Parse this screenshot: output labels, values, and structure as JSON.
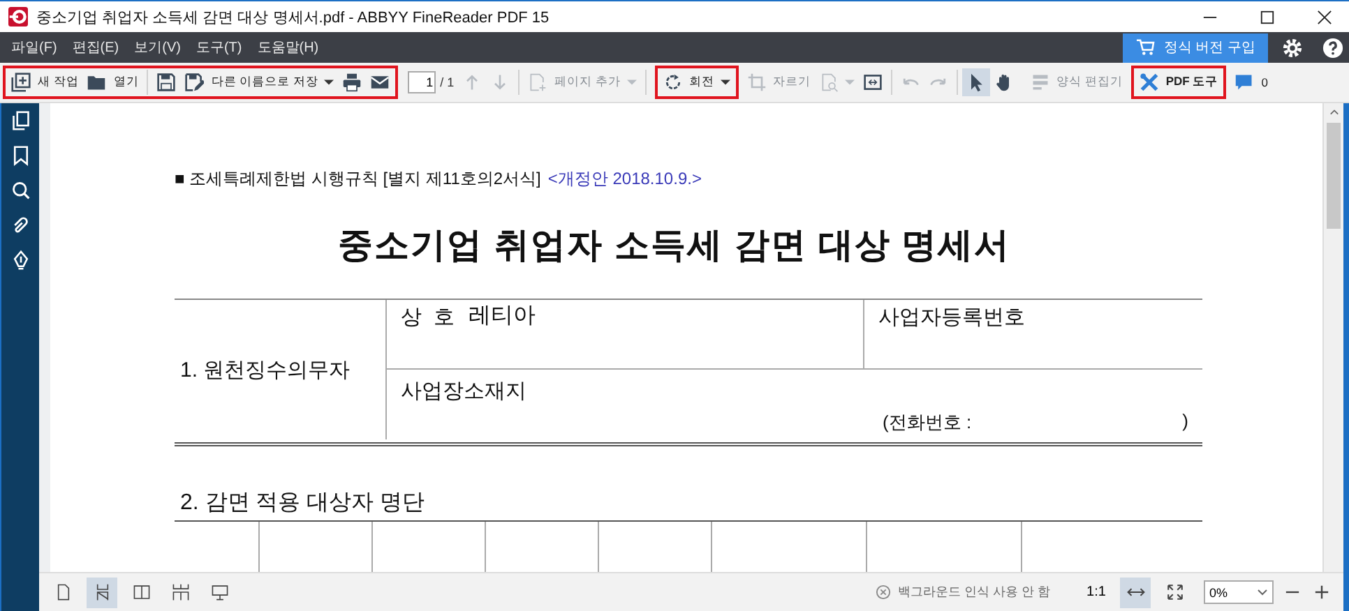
{
  "window": {
    "title": "중소기업 취업자 소득세 감면 대상 명세서.pdf - ABBYY FineReader PDF 15"
  },
  "menu": [
    "파일(F)",
    "편집(E)",
    "보기(V)",
    "도구(T)",
    "도움말(H)"
  ],
  "buy_button": "정식 버전 구입",
  "toolbar": [
    {
      "highlighted": true,
      "items": [
        {
          "kind": "new",
          "label": "새 작업",
          "disabled": false
        },
        {
          "kind": "open",
          "label": "열기",
          "disabled": false
        },
        {
          "kind": "divider"
        },
        {
          "kind": "save",
          "disabled": false
        },
        {
          "kind": "save-as",
          "label": "다른 이름으로 저장",
          "disabled": false,
          "dropdown": true
        },
        {
          "kind": "print",
          "disabled": false
        },
        {
          "kind": "mail",
          "disabled": false
        }
      ]
    },
    {
      "highlighted": false,
      "items": [
        {
          "kind": "page-field",
          "value": "1",
          "label": "/ 1"
        },
        {
          "kind": "up",
          "disabled": true
        },
        {
          "kind": "down",
          "disabled": true
        },
        {
          "kind": "divider"
        },
        {
          "kind": "add-page",
          "label": "페이지 추가",
          "disabled": true,
          "dropdown": true
        },
        {
          "kind": "divider"
        }
      ]
    },
    {
      "highlighted": true,
      "items": [
        {
          "kind": "rotate",
          "label": "회전",
          "disabled": false,
          "dropdown": true
        }
      ]
    },
    {
      "highlighted": false,
      "items": [
        {
          "kind": "crop",
          "label": "자르기",
          "disabled": true
        },
        {
          "kind": "doc-search",
          "disabled": true,
          "dropdown": true
        },
        {
          "kind": "compare",
          "disabled": false
        },
        {
          "kind": "divider"
        },
        {
          "kind": "undo",
          "disabled": true
        },
        {
          "kind": "redo",
          "disabled": true
        },
        {
          "kind": "divider"
        },
        {
          "kind": "select",
          "disabled": false,
          "selected": true
        },
        {
          "kind": "hand",
          "disabled": false,
          "selected": false
        }
      ]
    },
    {
      "highlighted": false,
      "items": [
        {
          "kind": "form-editor",
          "label": "양식 편집기",
          "disabled": true
        }
      ]
    },
    {
      "highlighted": true,
      "items": [
        {
          "kind": "pdf-tools",
          "label": "PDF 도구",
          "disabled": false
        }
      ]
    },
    {
      "highlighted": false,
      "items": [
        {
          "kind": "comments",
          "label": "0",
          "disabled": false
        }
      ]
    }
  ],
  "sidebar": [
    {
      "kind": "pages"
    },
    {
      "kind": "bookmark"
    },
    {
      "kind": "search"
    },
    {
      "kind": "attachment"
    },
    {
      "kind": "signature"
    }
  ],
  "document": {
    "header": "■ 조세특례제한법 시행규칙 [별지 제11호의2서식]",
    "revision": "<개정안 2018.10.9.>",
    "title": "중소기업 취업자 소득세 감면 대상 명세서",
    "section1": {
      "label": "1. 원천징수의무자",
      "company_label": "상  호",
      "company_value": "레티아",
      "reg_label": "사업자등록번호",
      "address_label": "사업장소재지",
      "phone_open": "(전화번호 :",
      "phone_close": ")"
    },
    "section2": {
      "label": "2. 감면 적용 대상자 명단"
    }
  },
  "status_bar": {
    "views": [
      {
        "kind": "single",
        "selected": false
      },
      {
        "kind": "scroll",
        "selected": true
      },
      {
        "kind": "two",
        "selected": false
      },
      {
        "kind": "two-scroll",
        "selected": false
      },
      {
        "kind": "present",
        "selected": false
      }
    ],
    "background": "백그라운드 인식 사용 안 함",
    "actual": "1:1",
    "fit_width_selected": true,
    "zoom": "0%"
  }
}
